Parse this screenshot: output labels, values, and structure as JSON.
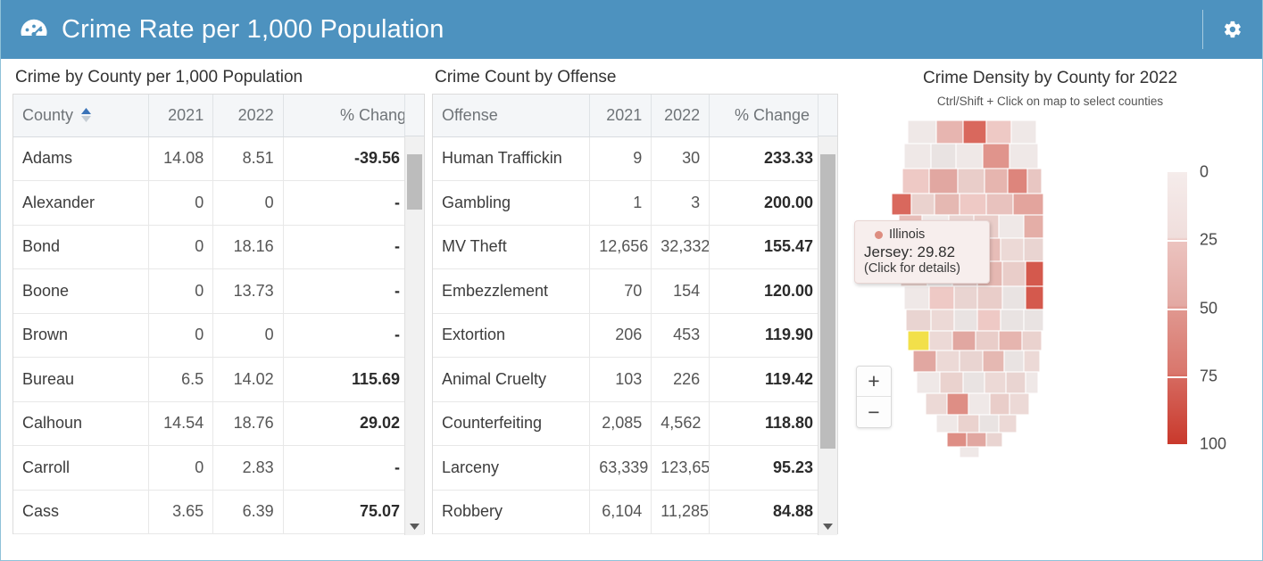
{
  "header": {
    "title": "Crime Rate per 1,000 Population",
    "icon": "gauge-icon",
    "settings_icon": "gear-icon",
    "bg_color": "#4d92bf"
  },
  "county_panel": {
    "title": "Crime by County per 1,000 Population",
    "columns": [
      "County",
      "2021",
      "2022",
      "% Change"
    ],
    "sort_column": "County",
    "sort_direction": "asc",
    "rows": [
      {
        "county": "Adams",
        "y2021": "14.08",
        "y2022": "8.51",
        "change": "-39.56",
        "trend": "down"
      },
      {
        "county": "Alexander",
        "y2021": "0",
        "y2022": "0",
        "change": "-",
        "trend": "none"
      },
      {
        "county": "Bond",
        "y2021": "0",
        "y2022": "18.16",
        "change": "-",
        "trend": "up"
      },
      {
        "county": "Boone",
        "y2021": "0",
        "y2022": "13.73",
        "change": "-",
        "trend": "up"
      },
      {
        "county": "Brown",
        "y2021": "0",
        "y2022": "0",
        "change": "-",
        "trend": "none"
      },
      {
        "county": "Bureau",
        "y2021": "6.5",
        "y2022": "14.02",
        "change": "115.69",
        "trend": "up"
      },
      {
        "county": "Calhoun",
        "y2021": "14.54",
        "y2022": "18.76",
        "change": "29.02",
        "trend": "up"
      },
      {
        "county": "Carroll",
        "y2021": "0",
        "y2022": "2.83",
        "change": "-",
        "trend": "up"
      },
      {
        "county": "Cass",
        "y2021": "3.65",
        "y2022": "6.39",
        "change": "75.07",
        "trend": "up"
      }
    ]
  },
  "offense_panel": {
    "title": "Crime Count by Offense",
    "columns": [
      "Offense",
      "2021",
      "2022",
      "% Change"
    ],
    "sort_column": "% Change",
    "sort_direction": "desc",
    "rows": [
      {
        "offense": "Human Traffickin",
        "y2021": "9",
        "y2022": "30",
        "change": "233.33",
        "trend": "up"
      },
      {
        "offense": "Gambling",
        "y2021": "1",
        "y2022": "3",
        "change": "200.00",
        "trend": "up"
      },
      {
        "offense": "MV Theft",
        "y2021": "12,656",
        "y2022": "32,332",
        "change": "155.47",
        "trend": "up"
      },
      {
        "offense": "Embezzlement",
        "y2021": "70",
        "y2022": "154",
        "change": "120.00",
        "trend": "up"
      },
      {
        "offense": "Extortion",
        "y2021": "206",
        "y2022": "453",
        "change": "119.90",
        "trend": "up"
      },
      {
        "offense": "Animal Cruelty",
        "y2021": "103",
        "y2022": "226",
        "change": "119.42",
        "trend": "up"
      },
      {
        "offense": "Counterfeiting",
        "y2021": "2,085",
        "y2022": "4,562",
        "change": "118.80",
        "trend": "up"
      },
      {
        "offense": "Larceny",
        "y2021": "63,339",
        "y2022": "123,65",
        "change": "95.23",
        "trend": "up"
      },
      {
        "offense": "Robbery",
        "y2021": "6,104",
        "y2022": "11,285",
        "change": "84.88",
        "trend": "up"
      }
    ]
  },
  "map_panel": {
    "title": "Crime Density by County for 2022",
    "subtitle": "Ctrl/Shift + Click on map to select counties",
    "tooltip": {
      "series": "Illinois",
      "value_line": "Jersey: 29.82",
      "hint": "(Click for details)",
      "dot_color": "#dd8d80"
    },
    "zoom_in_label": "+",
    "zoom_out_label": "−",
    "legend": {
      "ticks": [
        "0",
        "25",
        "50",
        "75",
        "100"
      ],
      "low_color": "#f5eceb",
      "high_color": "#c9392c"
    },
    "selected_county_color": "#f2e04a"
  }
}
